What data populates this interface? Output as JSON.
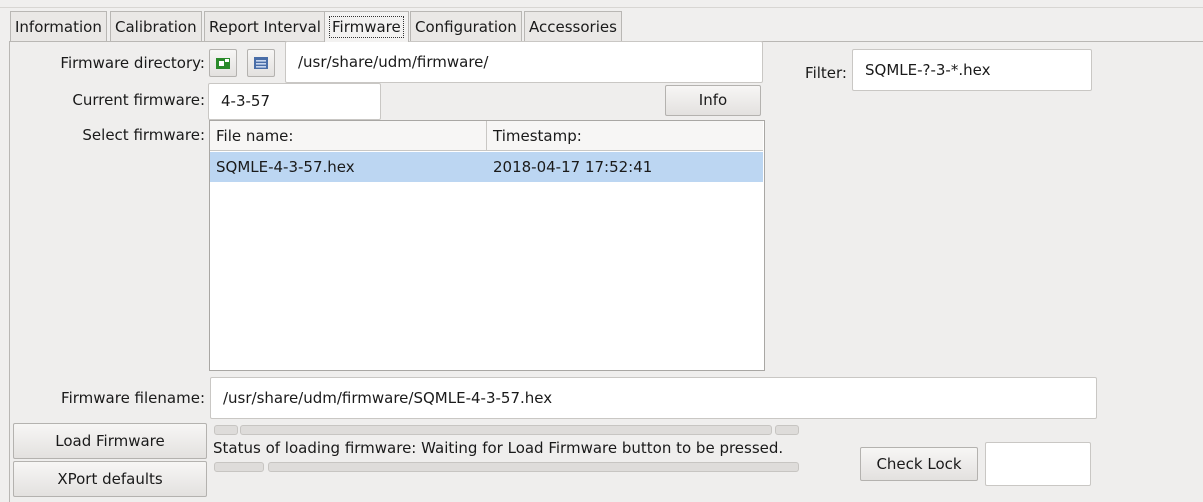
{
  "tabs": [
    {
      "label": "Information"
    },
    {
      "label": "Calibration"
    },
    {
      "label": "Report Interval"
    },
    {
      "label": "Firmware"
    },
    {
      "label": "Configuration"
    },
    {
      "label": "Accessories"
    }
  ],
  "firmware": {
    "directory_label": "Firmware directory:",
    "directory_value": "/usr/share/udm/firmware/",
    "filter_label": "Filter:",
    "filter_value": "SQMLE-?-3-*.hex",
    "current_label": "Current firmware:",
    "current_value": "4-3-57",
    "info_button": "Info",
    "select_label": "Select firmware:",
    "columns": [
      "File name:",
      "Timestamp:"
    ],
    "rows": [
      {
        "file": "SQMLE-4-3-57.hex",
        "timestamp": "2018-04-17 17:52:41"
      }
    ],
    "filename_label": "Firmware filename:",
    "filename_value": "/usr/share/udm/firmware/SQMLE-4-3-57.hex",
    "load_button": "Load Firmware",
    "xport_button": "XPort defaults",
    "status_text": "Status of loading firmware: Waiting for Load Firmware button to be pressed.",
    "check_lock_button": "Check Lock",
    "check_lock_value": ""
  },
  "icons": {
    "open_dir": "folder-refresh-icon",
    "browse": "list-icon"
  },
  "colors": {
    "selection": "#bcd6f2",
    "icon_green": "#2a8a2a",
    "icon_blue": "#4a6ea8"
  }
}
